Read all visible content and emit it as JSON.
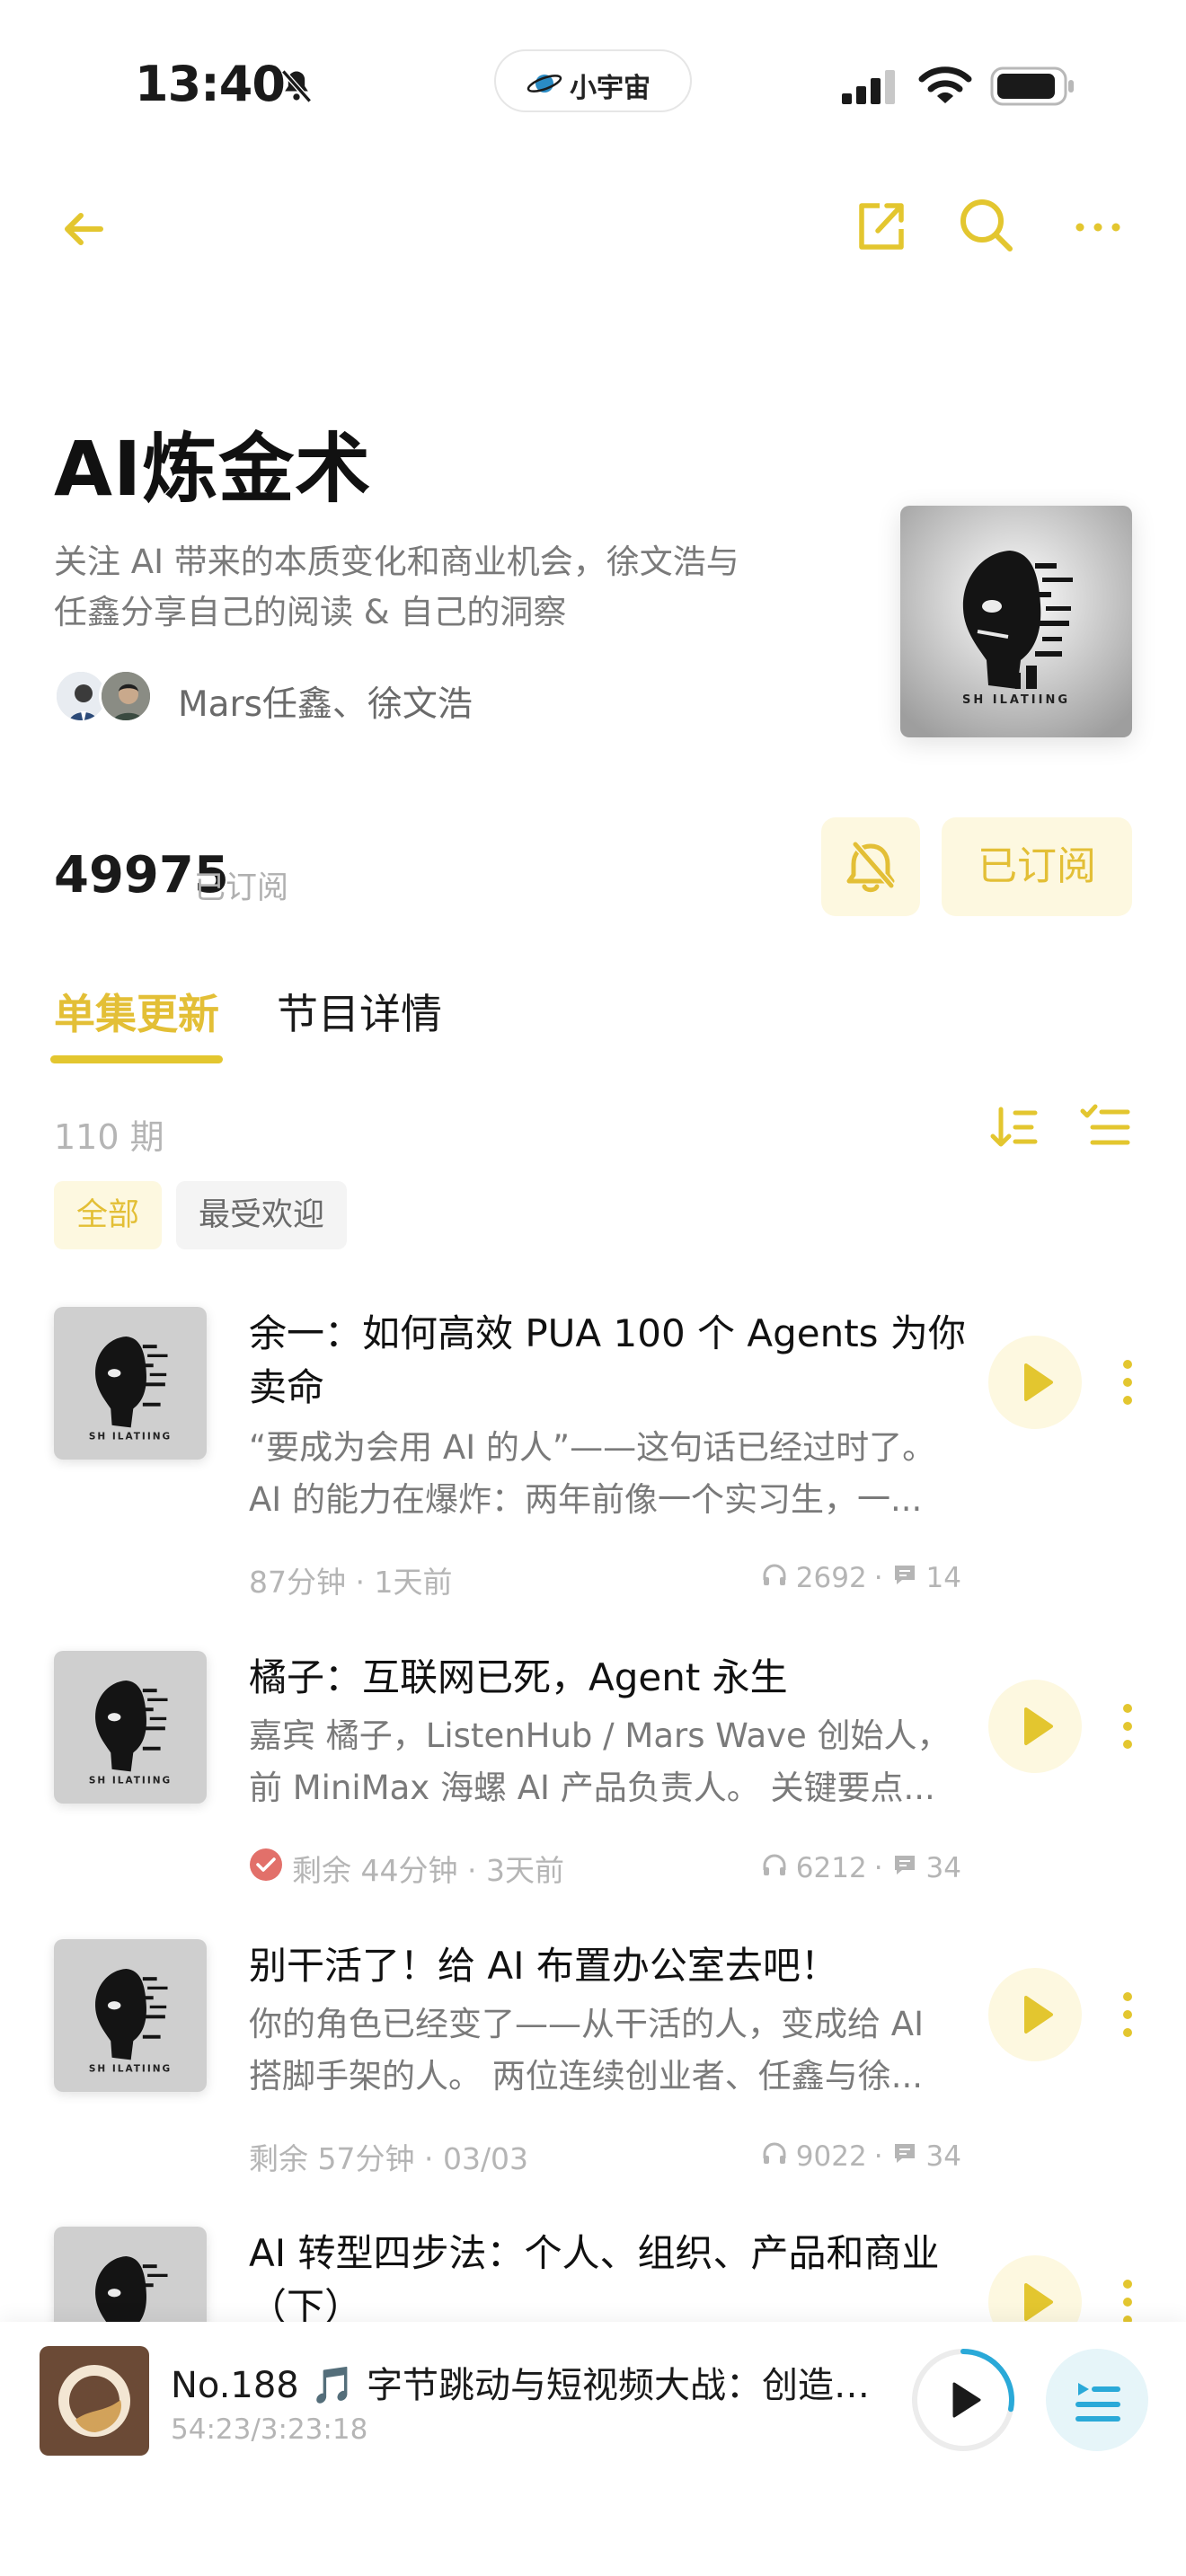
{
  "status_bar": {
    "time": "13:40",
    "brand": "小宇宙"
  },
  "podcast": {
    "title": "AI炼金术",
    "description_lines": [
      "关注 AI 带来的本质变化和商业机会，徐文浩与",
      "任鑫分享自己的阅读 & 自己的洞察"
    ],
    "hosts": "Mars任鑫、徐文浩",
    "cover_text": "SH ILATIING",
    "subscriber_count": "49975",
    "subscriber_label": "已订阅",
    "subscribed_button": "已订阅"
  },
  "tabs": {
    "episodes": "单集更新",
    "details": "节目详情"
  },
  "episode_list": {
    "count": "110 期",
    "filters": {
      "all": "全部",
      "popular": "最受欢迎"
    }
  },
  "episodes": [
    {
      "title": "余一：如何高效 PUA 100 个 Agents 为你卖命",
      "desc_lines": [
        "“要成为会用 AI 的人”——这句话已经过时了。",
        "AI 的能力在爆炸：两年前像一个实习生，一..."
      ],
      "meta": "87分钟 · 1天前",
      "listens": "2692",
      "comments": "14",
      "completed": false
    },
    {
      "title": "橘子：互联网已死，Agent 永生",
      "desc_lines": [
        "嘉宾 橘子，ListenHub / Mars Wave 创始人，",
        "前 MiniMax 海螺 AI 产品负责人。 关键要点..."
      ],
      "meta": "剩余 44分钟 · 3天前",
      "listens": "6212",
      "comments": "34",
      "completed": true
    },
    {
      "title": "别干活了！给 AI 布置办公室去吧！",
      "desc_lines": [
        "你的角色已经变了——从干活的人，变成给 AI",
        "搭脚手架的人。 两位连续创业者、任鑫与徐..."
      ],
      "meta": "剩余 57分钟 · 03/03",
      "listens": "9022",
      "comments": "34",
      "completed": false
    },
    {
      "title": "AI 转型四步法：个人、组织、产品和商业（下）",
      "desc_lines": [],
      "meta": "",
      "listens": "",
      "comments": "",
      "completed": false
    }
  ],
  "mini_player": {
    "title": "No.188 🎵 字节跳动与短视频大战：创造不...",
    "time": "54:23/3:23:18",
    "progress": 0.28
  },
  "colors": {
    "accent": "#e3c62f",
    "accent_soft": "#fdf8e0",
    "muted": "#b5b5b5"
  }
}
